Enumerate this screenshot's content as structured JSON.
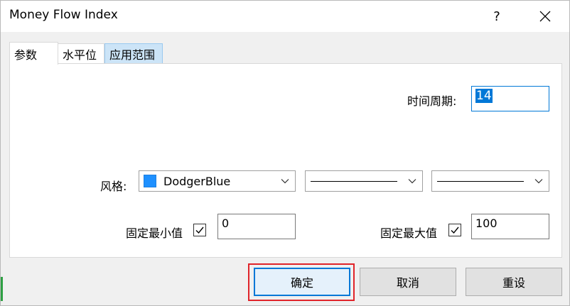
{
  "window": {
    "title": "Money Flow Index"
  },
  "titlebar": {
    "help_label": "?"
  },
  "tabs": [
    {
      "label": "参数",
      "active": true
    },
    {
      "label": "水平位",
      "active": false
    },
    {
      "label": "应用范围",
      "active": false
    }
  ],
  "params": {
    "period_label": "时间周期:",
    "period_value": "14",
    "style_label": "风格:",
    "color_value": "DodgerBlue",
    "color_hex": "#1E90FF",
    "min_label": "固定最小值",
    "min_checked": true,
    "min_value": "0",
    "max_label": "固定最大值",
    "max_checked": true,
    "max_value": "100"
  },
  "buttons": {
    "ok": "确定",
    "cancel": "取消",
    "reset": "重设"
  }
}
